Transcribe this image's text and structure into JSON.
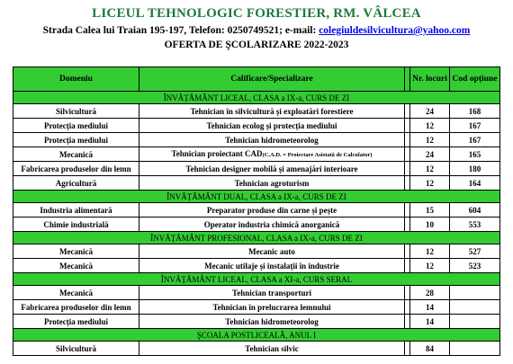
{
  "header": {
    "school": "LICEUL TEHNOLOGIC FORESTIER, RM. VÂLCEA",
    "address": "Strada Calea lui Traian 195-197, Telefon: 0250749521; e-mail: ",
    "email": "colegiuldesilvicultura@yahoo.com",
    "offer": "OFERTA DE ŞCOLARIZARE 2022-2023"
  },
  "table": {
    "columns": [
      "Domeniu",
      "Calificare/Specializare",
      "Nr. locuri",
      "Cod opțiune"
    ],
    "sections": [
      {
        "title": "ÎNVĂȚĂMÂNT LICEAL, CLASA a IX-a, CURS DE ZI",
        "rows": [
          {
            "domain": "Silvicultură",
            "qualification": "Tehnician în silvicultură și exploatări forestiere",
            "places": "24",
            "code": "168"
          },
          {
            "domain": "Protecția mediului",
            "qualification": "Tehnician ecolog și protecția mediului",
            "places": "12",
            "code": "167"
          },
          {
            "domain": "Protecția mediului",
            "qualification": "Tehnician hidrometeorolog",
            "places": "12",
            "code": "167"
          },
          {
            "domain": "Mecanică",
            "qualification": "Tehnician proiectant CAD",
            "note": "(C.A.D. = Proiectare Asistată de Calculator)",
            "places": "24",
            "code": "165"
          },
          {
            "domain": "Fabricarea produselor din lemn",
            "qualification": "Tehnician designer mobilă și amenajări interioare",
            "places": "12",
            "code": "180"
          },
          {
            "domain": "Agricultură",
            "qualification": "Tehnician agroturism",
            "places": "12",
            "code": "164"
          }
        ]
      },
      {
        "title": "ÎNVĂȚĂMÂNT DUAL, CLASA a IX-a, CURS DE ZI",
        "rows": [
          {
            "domain": "Industria alimentară",
            "qualification": "Preparator produse din carne și pește",
            "places": "15",
            "code": "604"
          },
          {
            "domain": "Chimie industrială",
            "qualification": "Operator industria chimică anorganică",
            "places": "10",
            "code": "553"
          }
        ]
      },
      {
        "title": "ÎNVĂȚĂMÂNT PROFESIONAL, CLASA a IX-a, CURS DE ZI",
        "rows": [
          {
            "domain": "Mecanică",
            "qualification": "Mecanic auto",
            "places": "12",
            "code": "527"
          },
          {
            "domain": "Mecanică",
            "qualification": "Mecanic utilaje și instalații în industrie",
            "places": "12",
            "code": "523"
          }
        ]
      },
      {
        "title": "ÎNVĂȚĂMÂNT LICEAL, CLASA a XI-a, CURS SERAL",
        "rows": [
          {
            "domain": "Mecanică",
            "qualification": "Tehnician transporturi",
            "places": "28",
            "code": ""
          },
          {
            "domain": "Fabricarea produselor din lemn",
            "qualification": "Tehnician în prelucrarea lemnului",
            "places": "14",
            "code": ""
          },
          {
            "domain": "Protecția mediului",
            "qualification": "Tehnician hidrometeorolog",
            "places": "14",
            "code": ""
          }
        ]
      },
      {
        "title": "ŞCOALA POSTLICEALĂ, ANUL I",
        "rows": [
          {
            "domain": "Silvicultură",
            "qualification": "Tehnician silvic",
            "places": "84",
            "code": ""
          }
        ]
      }
    ]
  },
  "colors": {
    "title": "#1a7a3c",
    "band": "#33cc33",
    "link": "#0000ee"
  }
}
